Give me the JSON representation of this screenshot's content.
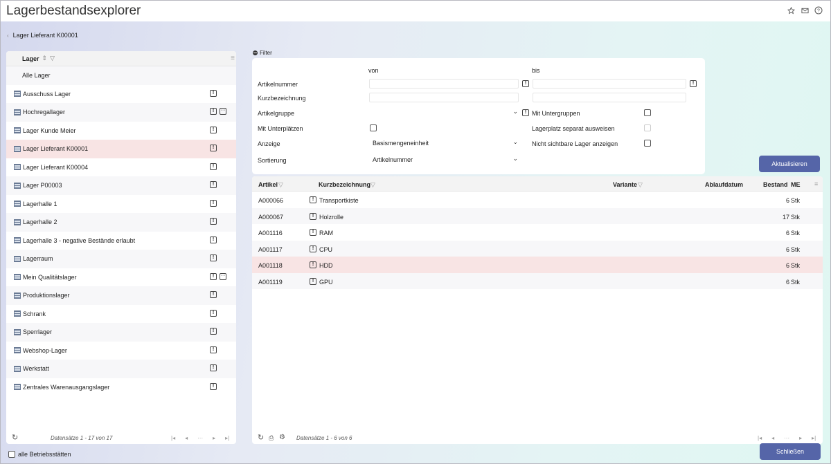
{
  "app": {
    "title": "Lagerbestandsexplorer"
  },
  "breadcrumb": {
    "current": "Lager Lieferant K00001"
  },
  "left": {
    "header": "Lager",
    "all_label": "Alle Lager",
    "items": [
      {
        "label": "Ausschuss Lager",
        "info": "!",
        "more": ""
      },
      {
        "label": "Hochregallager",
        "info": "!",
        "more": "···"
      },
      {
        "label": "Lager Kunde Meier",
        "info": "!",
        "more": ""
      },
      {
        "label": "Lager Lieferant K00001",
        "info": "!",
        "more": ""
      },
      {
        "label": "Lager Lieferant K00004",
        "info": "!",
        "more": ""
      },
      {
        "label": "Lager P00003",
        "info": "!",
        "more": ""
      },
      {
        "label": "Lagerhalle 1",
        "info": "!",
        "more": ""
      },
      {
        "label": "Lagerhalle 2",
        "info": "!",
        "more": ""
      },
      {
        "label": "Lagerhalle 3 - negative Bestände erlaubt",
        "info": "!",
        "more": ""
      },
      {
        "label": "Lagerraum",
        "info": "!",
        "more": ""
      },
      {
        "label": "Mein Qualitätslager",
        "info": "!",
        "more": "···"
      },
      {
        "label": "Produktionslager",
        "info": "!",
        "more": ""
      },
      {
        "label": "Schrank",
        "info": "!",
        "more": ""
      },
      {
        "label": "Sperrlager",
        "info": "!",
        "more": ""
      },
      {
        "label": "Webshop-Lager",
        "info": "!",
        "more": ""
      },
      {
        "label": "Werkstatt",
        "info": "!",
        "more": ""
      },
      {
        "label": "Zentrales Warenausgangslager",
        "info": "!",
        "more": ""
      }
    ],
    "selected_index": 3,
    "pager_text": "Datensätze 1 - 17 von 17"
  },
  "filter": {
    "toggle_label": "Filter",
    "von": "von",
    "bis": "bis",
    "artikelnummer_label": "Artikelnummer",
    "kurzbezeichnung_label": "Kurzbezeichnung",
    "artikelgruppe_label": "Artikelgruppe",
    "mit_untergruppen_label": "Mit Untergruppen",
    "mit_unterplaetzen_label": "Mit Unterplätzen",
    "lagerplatz_separat_label": "Lagerplatz separat ausweisen",
    "anzeige_label": "Anzeige",
    "anzeige_value": "Basismengeneinheit",
    "nicht_sichtbare_label": "Nicht sichtbare Lager anzeigen",
    "sortierung_label": "Sortierung",
    "sortierung_value": "Artikelnummer",
    "aktualisieren_label": "Aktualisieren"
  },
  "results": {
    "columns": {
      "artikel": "Artikel",
      "kurzbezeichnung": "Kurzbezeichnung",
      "variante": "Variante",
      "ablaufdatum": "Ablaufdatum",
      "bestand": "Bestand",
      "me": "ME"
    },
    "rows": [
      {
        "artikel": "A000066",
        "kurzbezeichnung": "Transportkiste",
        "bestand": "6",
        "me": "Stk"
      },
      {
        "artikel": "A000067",
        "kurzbezeichnung": "Holzrolle",
        "bestand": "17",
        "me": "Stk"
      },
      {
        "artikel": "A001116",
        "kurzbezeichnung": "RAM",
        "bestand": "6",
        "me": "Stk"
      },
      {
        "artikel": "A001117",
        "kurzbezeichnung": "CPU",
        "bestand": "6",
        "me": "Stk"
      },
      {
        "artikel": "A001118",
        "kurzbezeichnung": "HDD",
        "bestand": "6",
        "me": "Stk"
      },
      {
        "artikel": "A001119",
        "kurzbezeichnung": "GPU",
        "bestand": "6",
        "me": "Stk"
      }
    ],
    "selected_index": 4,
    "pager_text": "Datensätze 1 - 6 von 6"
  },
  "footer": {
    "alle_betriebsstaetten_label": "alle Betriebsstätten",
    "schliessen_label": "Schließen"
  },
  "colors": {
    "accent": "#5565a8",
    "selected_row": "#f8e4e4"
  },
  "icons": {
    "star": "star-icon",
    "mail": "mail-icon",
    "help": "help-icon",
    "refresh": "refresh-icon",
    "print": "print-icon",
    "settings": "gear-icon"
  }
}
